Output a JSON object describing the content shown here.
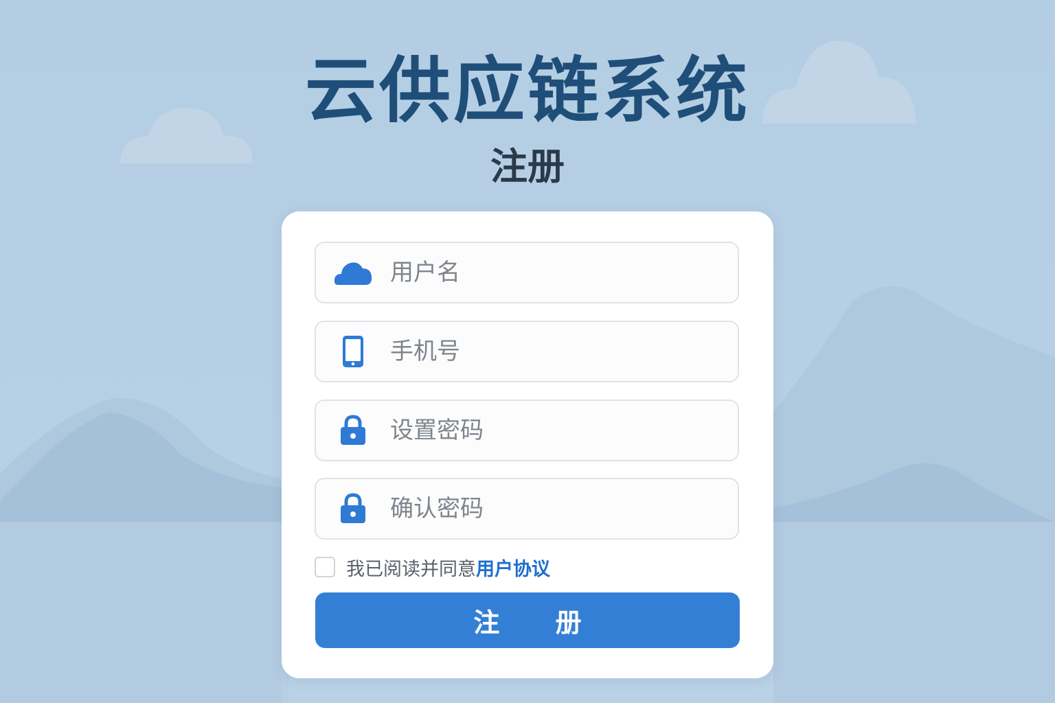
{
  "header": {
    "app_title": "云供应链系统",
    "page_title": "注册"
  },
  "form": {
    "username": {
      "placeholder": "用户名",
      "icon": "cloud-icon",
      "value": ""
    },
    "phone": {
      "placeholder": "手机号",
      "icon": "phone-icon",
      "value": ""
    },
    "password": {
      "placeholder": "设置密码",
      "icon": "lock-icon",
      "value": ""
    },
    "confirm_password": {
      "placeholder": "确认密码",
      "icon": "lock-icon",
      "value": ""
    },
    "agreement": {
      "text": "我已阅读并同意",
      "link": "用户协议",
      "checked": false
    },
    "submit_label": "注 册"
  },
  "colors": {
    "accent": "#347fd6",
    "title": "#1f4e79",
    "background": "#b7cfe4",
    "link": "#1e6fd0"
  }
}
